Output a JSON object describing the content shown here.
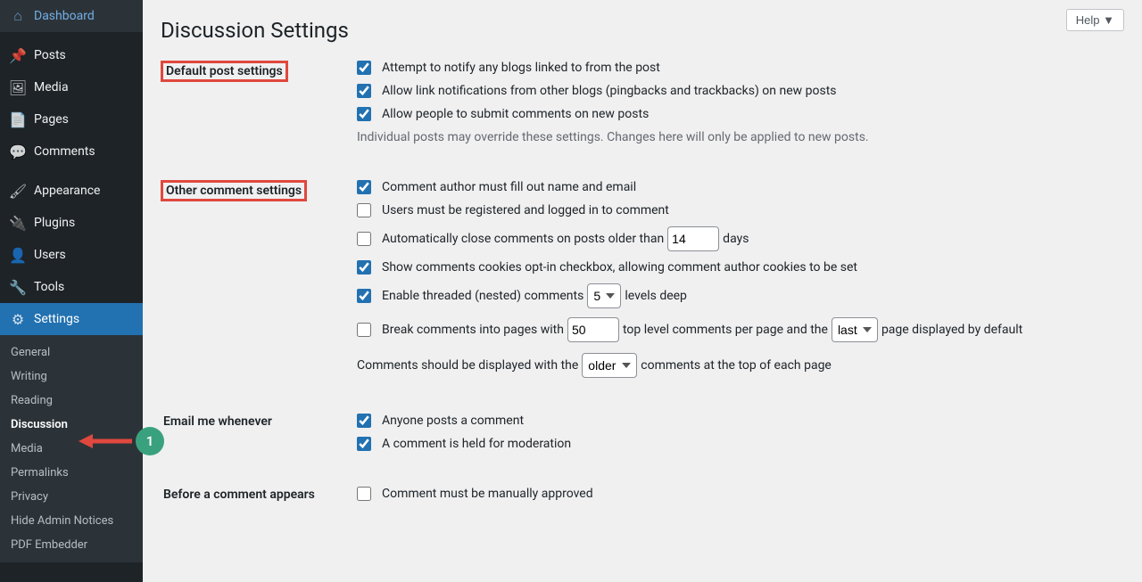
{
  "help_label": "Help ▼",
  "page_title": "Discussion Settings",
  "annotation_badge": "1",
  "sidebar": {
    "items": [
      {
        "label": "Dashboard",
        "icon": "⌂"
      },
      {
        "label": "Posts",
        "icon": "📌"
      },
      {
        "label": "Media",
        "icon": "🖼"
      },
      {
        "label": "Pages",
        "icon": "📄"
      },
      {
        "label": "Comments",
        "icon": "💬"
      },
      {
        "label": "Appearance",
        "icon": "🖌"
      },
      {
        "label": "Plugins",
        "icon": "🔌"
      },
      {
        "label": "Users",
        "icon": "👤"
      },
      {
        "label": "Tools",
        "icon": "🔧"
      },
      {
        "label": "Settings",
        "icon": "⚙"
      }
    ],
    "submenu": {
      "items": [
        {
          "label": "General"
        },
        {
          "label": "Writing"
        },
        {
          "label": "Reading"
        },
        {
          "label": "Discussion"
        },
        {
          "label": "Media"
        },
        {
          "label": "Permalinks"
        },
        {
          "label": "Privacy"
        },
        {
          "label": "Hide Admin Notices"
        },
        {
          "label": "PDF Embedder"
        }
      ]
    }
  },
  "sections": {
    "default_post": {
      "heading": "Default post settings",
      "opt1": "Attempt to notify any blogs linked to from the post",
      "opt2": "Allow link notifications from other blogs (pingbacks and trackbacks) on new posts",
      "opt3": "Allow people to submit comments on new posts",
      "note": "Individual posts may override these settings. Changes here will only be applied to new posts."
    },
    "other_comment": {
      "heading": "Other comment settings",
      "opt1": "Comment author must fill out name and email",
      "opt2": "Users must be registered and logged in to comment",
      "opt3a": "Automatically close comments on posts older than",
      "opt3_value": "14",
      "opt3b": "days",
      "opt4": "Show comments cookies opt-in checkbox, allowing comment author cookies to be set",
      "opt5a": "Enable threaded (nested) comments",
      "opt5_value": "5",
      "opt5b": "levels deep",
      "opt6a": "Break comments into pages with",
      "opt6_value": "50",
      "opt6b": "top level comments per page and the",
      "opt6_select": "last",
      "opt6c": "page displayed by default",
      "opt7a": "Comments should be displayed with the",
      "opt7_select": "older",
      "opt7b": "comments at the top of each page"
    },
    "email_me": {
      "heading": "Email me whenever",
      "opt1": "Anyone posts a comment",
      "opt2": "A comment is held for moderation"
    },
    "before_appears": {
      "heading": "Before a comment appears",
      "opt1": "Comment must be manually approved"
    }
  }
}
